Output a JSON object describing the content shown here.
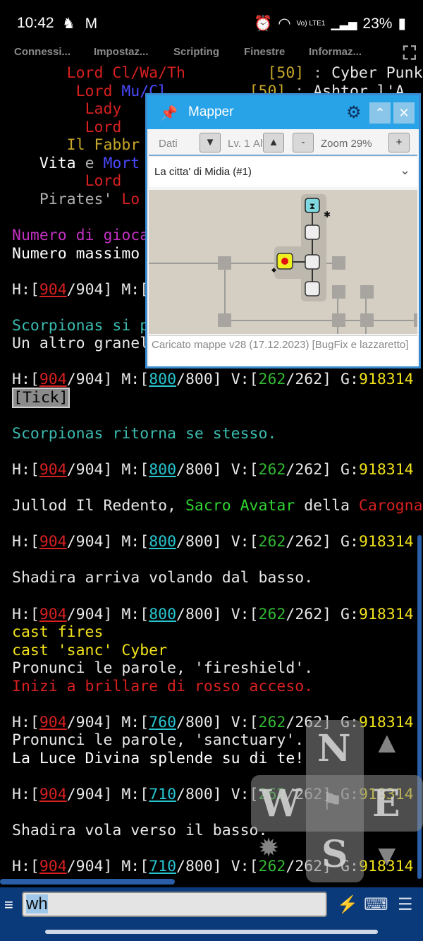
{
  "status_bar": {
    "time": "10:42",
    "left_icons": "♞ M",
    "battery": "23%",
    "net_label": "Vo) LTE1"
  },
  "menu": {
    "items": [
      "Connessi...",
      "Impostaz...",
      "Scripting",
      "Finestre",
      "Informaz..."
    ]
  },
  "terminal": {
    "lines": [
      {
        "segs": [
          {
            "t": "      "
          },
          {
            "t": "Lord Cl/Wa/Th",
            "c": "red"
          },
          {
            "t": "         "
          },
          {
            "t": "[50]",
            "c": "olive"
          },
          {
            "t": " : ",
            "c": "gray"
          },
          {
            "t": "Cyber Punk",
            "c": "white"
          }
        ]
      },
      {
        "segs": [
          {
            "t": "       "
          },
          {
            "t": "Lord ",
            "c": "red"
          },
          {
            "t": "Mu/Cl",
            "c": "blue"
          },
          {
            "t": "         "
          },
          {
            "t": "[50]",
            "c": "olive"
          },
          {
            "t": " : ",
            "c": "gray"
          },
          {
            "t": "Ashtor l'A",
            "c": "white"
          }
        ]
      },
      {
        "segs": [
          {
            "t": "        "
          },
          {
            "t": "Lady",
            "c": "red"
          }
        ]
      },
      {
        "segs": [
          {
            "t": "        "
          },
          {
            "t": "Lord",
            "c": "red"
          }
        ]
      },
      {
        "segs": [
          {
            "t": "      "
          },
          {
            "t": "Il Fabbr",
            "c": "olive"
          }
        ]
      },
      {
        "segs": [
          {
            "t": "   "
          },
          {
            "t": "Vita",
            "c": "bright"
          },
          {
            "t": " e ",
            "c": "gray"
          },
          {
            "t": "Mort",
            "c": "blue"
          }
        ]
      },
      {
        "segs": [
          {
            "t": "        "
          },
          {
            "t": "Lord",
            "c": "red"
          }
        ]
      },
      {
        "segs": [
          {
            "t": "   "
          },
          {
            "t": "Pirates'",
            "c": "gray"
          },
          {
            "t": " Lo",
            "c": "red"
          }
        ]
      },
      {
        "segs": []
      },
      {
        "segs": [
          {
            "t": "Numero di gioca",
            "c": "magenta"
          }
        ]
      },
      {
        "segs": [
          {
            "t": "Numero massimo",
            "c": "bright"
          }
        ]
      },
      {
        "segs": []
      },
      {
        "segs": [
          {
            "t": "H:[",
            "c": "white"
          },
          {
            "t": "904",
            "c": "red",
            "u": true
          },
          {
            "t": "/904] M:[",
            "c": "white"
          }
        ]
      },
      {
        "segs": []
      },
      {
        "segs": [
          {
            "t": "Scorpionas si p",
            "c": "cyan"
          }
        ]
      },
      {
        "segs": [
          {
            "t": "Un altro granel",
            "c": "white"
          }
        ]
      },
      {
        "segs": []
      },
      {
        "prompt": {
          "h": "904",
          "hmax": "904",
          "m": "800",
          "mmax": "800",
          "v": "262",
          "vmax": "262",
          "g": "918314"
        }
      },
      {
        "segs": [
          {
            "t": "[Tick]",
            "c": "tick"
          }
        ]
      },
      {
        "segs": []
      },
      {
        "segs": [
          {
            "t": "Scorpionas ritorna se stesso.",
            "c": "cyan"
          }
        ]
      },
      {
        "segs": []
      },
      {
        "prompt": {
          "h": "904",
          "hmax": "904",
          "m": "800",
          "mmax": "800",
          "v": "262",
          "vmax": "262",
          "g": "918314"
        }
      },
      {
        "segs": []
      },
      {
        "segs": [
          {
            "t": "Jullod Il Redento, ",
            "c": "white"
          },
          {
            "t": "Sacro Avatar",
            "c": "lightgreen"
          },
          {
            "t": " della ",
            "c": "white"
          },
          {
            "t": "Carogna",
            "c": "red"
          }
        ]
      },
      {
        "segs": []
      },
      {
        "prompt": {
          "h": "904",
          "hmax": "904",
          "m": "800",
          "mmax": "800",
          "v": "262",
          "vmax": "262",
          "g": "918314"
        }
      },
      {
        "segs": []
      },
      {
        "segs": [
          {
            "t": "Shadira arriva volando dal basso.",
            "c": "white"
          }
        ]
      },
      {
        "segs": []
      },
      {
        "prompt": {
          "h": "904",
          "hmax": "904",
          "m": "800",
          "mmax": "800",
          "v": "262",
          "vmax": "262",
          "g": "918314"
        }
      },
      {
        "segs": [
          {
            "t": "cast fires",
            "c": "yellow"
          }
        ]
      },
      {
        "segs": [
          {
            "t": "cast 'sanc' Cyber",
            "c": "yellow"
          }
        ]
      },
      {
        "segs": [
          {
            "t": "Pronunci le parole, 'fireshield'.",
            "c": "white"
          }
        ]
      },
      {
        "segs": [
          {
            "t": "Inizi a brillare di rosso acceso.",
            "c": "red"
          }
        ]
      },
      {
        "segs": []
      },
      {
        "prompt": {
          "h": "904",
          "hmax": "904",
          "m": "760",
          "mmax": "800",
          "v": "262",
          "vmax": "262",
          "g": "918314"
        }
      },
      {
        "segs": [
          {
            "t": "Pronunci le parole, 'sanctuary'.",
            "c": "white"
          }
        ]
      },
      {
        "segs": [
          {
            "t": "La Luce Divina splende su di te!",
            "c": "bright"
          }
        ]
      },
      {
        "segs": []
      },
      {
        "prompt": {
          "h": "904",
          "hmax": "904",
          "m": "710",
          "mmax": "800",
          "v": "262",
          "vmax": "262",
          "g": "918314"
        }
      },
      {
        "segs": []
      },
      {
        "segs": [
          {
            "t": "Shadira vola verso il basso.",
            "c": "white"
          }
        ]
      },
      {
        "segs": []
      },
      {
        "prompt": {
          "h": "904",
          "hmax": "904",
          "m": "710",
          "mmax": "800",
          "v": "262",
          "vmax": "262",
          "g": "918314"
        }
      }
    ]
  },
  "mapper": {
    "title": "Mapper",
    "pin_icon": "pin-icon",
    "toolbar": {
      "dati": "Dati",
      "livello": "Lv. 1",
      "alt": "Alt",
      "zoom": "Zoom 29%",
      "down": "▼",
      "up": "▲",
      "minus": "-",
      "plus": "+"
    },
    "area": "La citta' di Midia (#1)",
    "status": "Caricato mappe v28 (17.12.2023) [BugFix e lazzaretto]"
  },
  "dpad": {
    "n": "N",
    "w": "W",
    "e": "E",
    "s": "S"
  },
  "input": {
    "value": "wh"
  },
  "colors": {
    "accent": "#29a3e8",
    "input_bar": "#0a3a7a",
    "health": "#d82020",
    "mana": "#28c6d0",
    "moves": "#32b932",
    "gold": "#f2e21a"
  }
}
